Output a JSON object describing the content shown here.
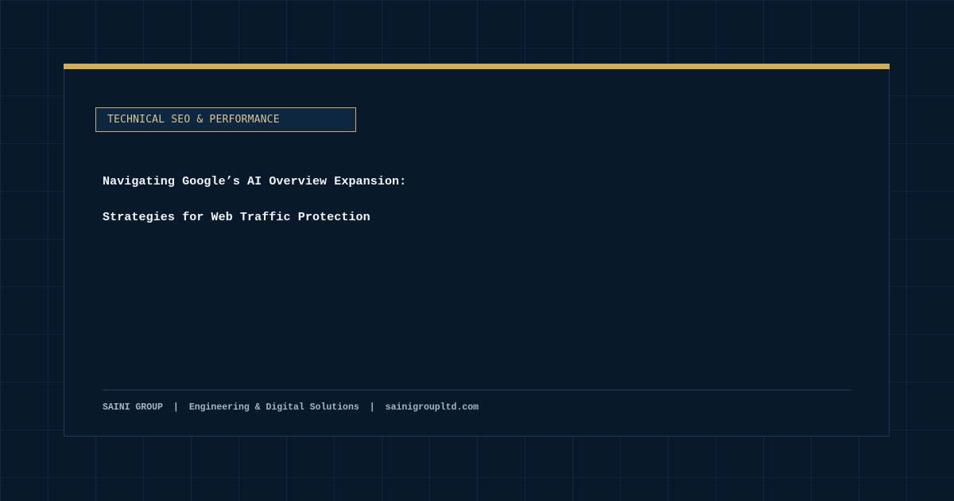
{
  "card": {
    "category": "TECHNICAL SEO & PERFORMANCE",
    "title_line_1": "Navigating Google’s AI Overview Expansion:",
    "title_line_2": "Strategies for Web Traffic Protection"
  },
  "footer": {
    "brand": "SAINI GROUP",
    "separator": "|",
    "tagline": "Engineering & Digital Solutions",
    "website": "sainigroupltd.com"
  },
  "colors": {
    "background": "#08192c",
    "accent_gold": "#d2ad52",
    "badge_text": "#d9c58e",
    "title_text": "#f2f4f7",
    "footer_text": "#a9b4c2"
  }
}
